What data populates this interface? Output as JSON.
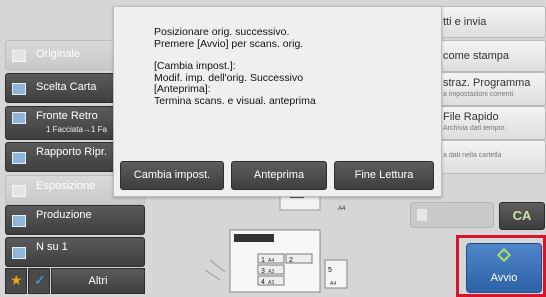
{
  "left_panel": {
    "items": [
      {
        "label": "Originale",
        "sub": "",
        "ghost": "Au",
        "disabled": true,
        "icon": "document-icon"
      },
      {
        "label": "Scelta Carta",
        "sub": "",
        "ghost": "",
        "disabled": false,
        "icon": "paper-tray-icon"
      },
      {
        "label": "Fronte Retro",
        "sub": "1 Facciata→1 Fa",
        "ghost": "",
        "disabled": false,
        "icon": "duplex-icon"
      },
      {
        "label": "Rapporto Ripr.",
        "sub": "",
        "ghost": "",
        "disabled": false,
        "icon": "zoom-ratio-icon"
      },
      {
        "label": "Esposizione",
        "sub": "",
        "ghost": "",
        "disabled": true,
        "icon": "exposure-icon"
      },
      {
        "label": "Produzione",
        "sub": "",
        "ghost": "",
        "disabled": false,
        "icon": "output-icon"
      },
      {
        "label": "N su 1",
        "sub": "",
        "ghost": "",
        "disabled": false,
        "icon": "n-up-icon"
      }
    ],
    "altri_label": "Altri"
  },
  "right_panel": {
    "items": [
      {
        "label": "tti e invia",
        "sub": ""
      },
      {
        "label": "come stampa",
        "sub": ""
      },
      {
        "label": "straz. Programma",
        "sub": "a impostazioni correnti"
      },
      {
        "label": "File Rapido",
        "sub": "Archivia dati tempor."
      },
      {
        "label": "",
        "sub": "a dati nella cartella"
      }
    ],
    "ca_label": "CA",
    "avvio_label": "Avvio"
  },
  "modal": {
    "lines": [
      "Posizionare orig. successivo.",
      "Premere [Avvio] per scans. orig.",
      "",
      "[Cambia impost.]:",
      "Modif. imp. dell'orig. Successivo",
      "[Anteprima]:",
      "Termina scans. e visual. anteprima"
    ],
    "buttons": {
      "change": "Cambia impost.",
      "preview": "Anteprima",
      "finish": "Fine Lettura"
    }
  },
  "machine": {
    "tray_labels": [
      "A4",
      "A4",
      "A3",
      "A4",
      "A3"
    ],
    "tray_numbers": [
      "1",
      "2",
      "3",
      "4",
      "5"
    ]
  },
  "colors": {
    "accent_blue": "#2e61a6",
    "highlight_red": "#d6142b",
    "dark_button": "#4a4a4a"
  }
}
